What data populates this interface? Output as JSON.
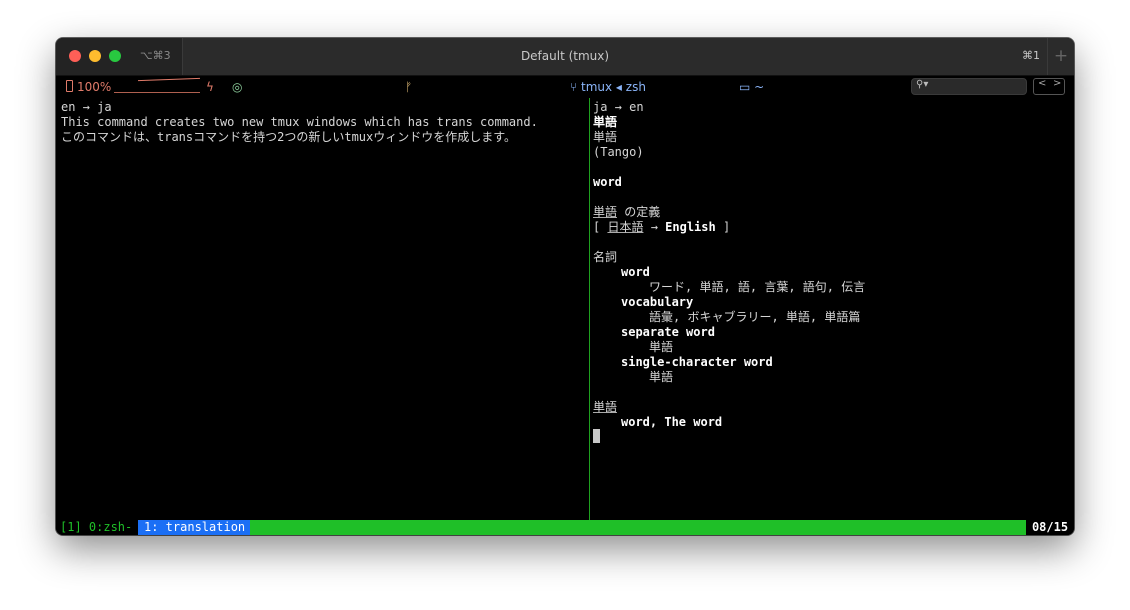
{
  "window": {
    "title": "Default (tmux)",
    "tab_shortcut": "⌥⌘3",
    "shortcut_right": "⌘1",
    "new_tab_label": "+"
  },
  "statusbar": {
    "battery": "100%",
    "bolt": "ϟ",
    "wifi": "◎",
    "git": "ᚠ",
    "tmux_session": "tmux ◂ zsh",
    "folder": "~",
    "search_placeholder": "",
    "nav_prev": "<",
    "nav_next": ">"
  },
  "left_pane": {
    "lines": [
      "en → ja",
      "This command creates two new tmux windows which has trans command.",
      "このコマンドは、transコマンドを持つ2つの新しいtmuxウィンドウを作成します。"
    ]
  },
  "right_pane": {
    "header": "ja → en",
    "word": "単語",
    "word_again": "単語",
    "reading": "(Tango)",
    "translation": "word",
    "definition_title_word": "単語",
    "definition_title_suffix": " の定義",
    "lang_open": "[ ",
    "lang_from": "日本語",
    "lang_arrow": " → ",
    "lang_to": "English",
    "lang_close": " ]",
    "pos": "名詞",
    "entries": [
      {
        "term": "word",
        "gloss": "ワード, 単語, 語, 言葉, 語句, 伝言"
      },
      {
        "term": "vocabulary",
        "gloss": "語彙, ボキャブラリー, 単語, 単語篇"
      },
      {
        "term": "separate word",
        "gloss": "単語"
      },
      {
        "term": "single-character word",
        "gloss": "単語"
      }
    ],
    "example_word": "単語",
    "example_first": "word",
    "example_rest": ", The word"
  },
  "tmux": {
    "session_windows": "[1] 0:zsh-",
    "active_window": "1: translation",
    "clock": "08/15"
  }
}
